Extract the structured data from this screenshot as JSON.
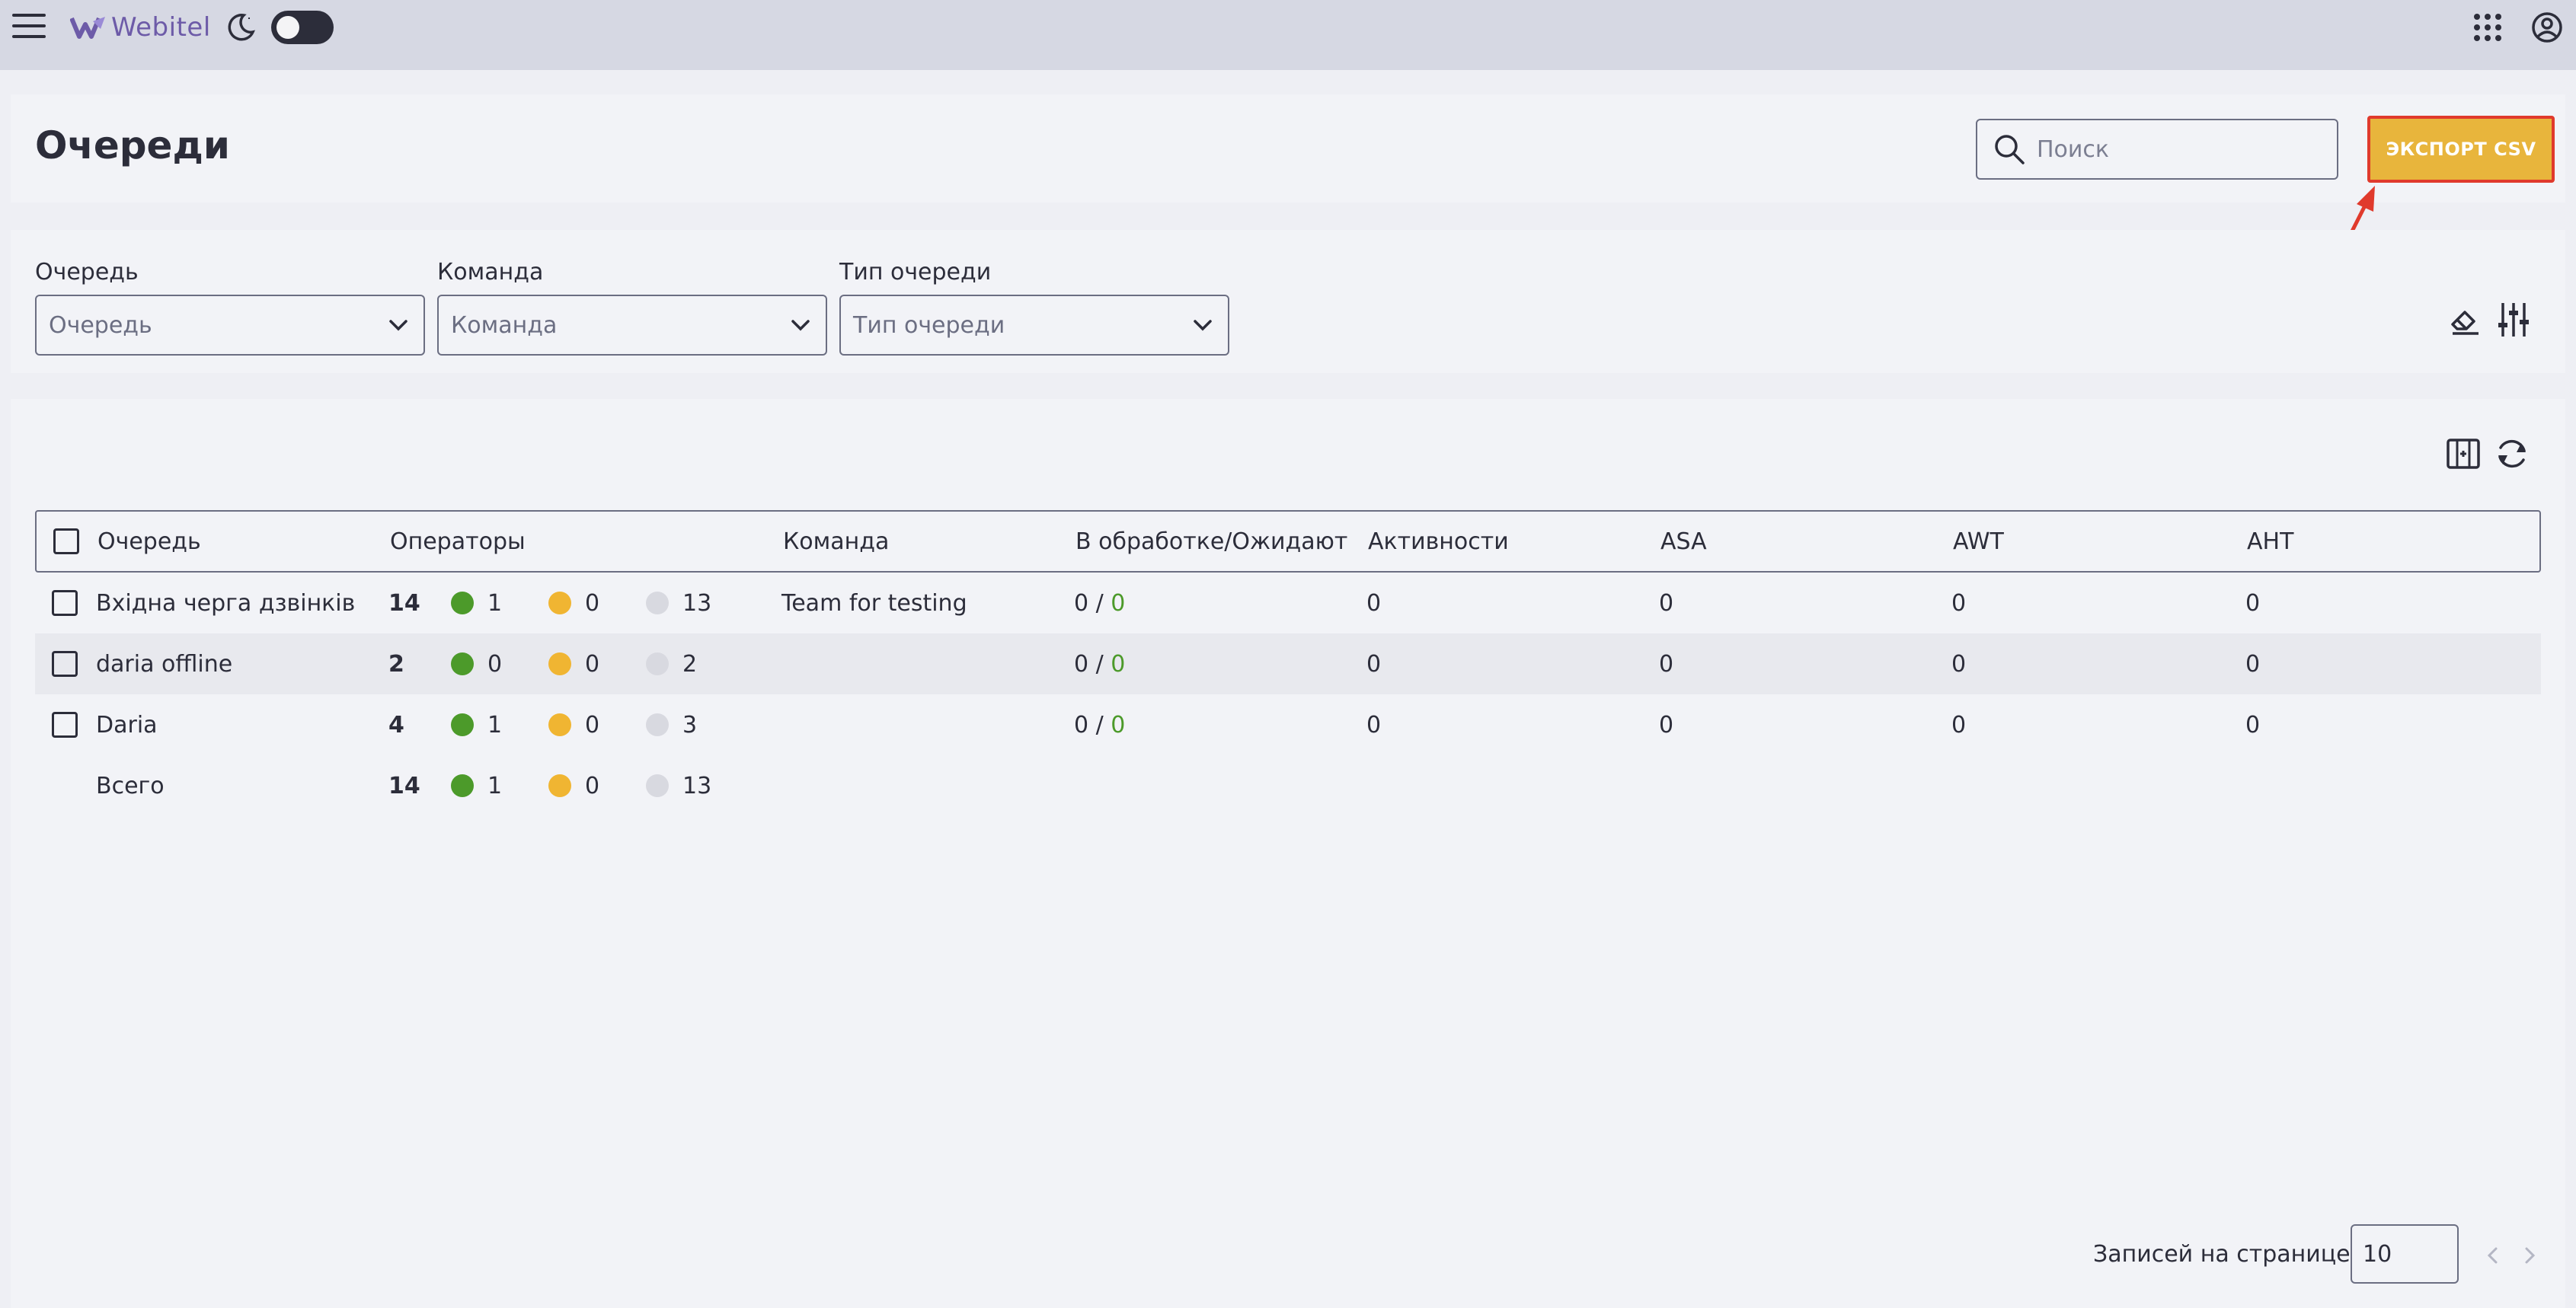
{
  "app": {
    "logo_text": "Webitel",
    "brand_color": "#6d5ba8"
  },
  "header": {
    "title": "Очереди",
    "search_placeholder": "Поиск",
    "export_label": "ЭКСПОРТ CSV",
    "export_color": "#e8b53c",
    "highlight_color": "#e03a2c"
  },
  "filters": [
    {
      "label": "Очередь",
      "placeholder": "Очередь"
    },
    {
      "label": "Команда",
      "placeholder": "Команда"
    },
    {
      "label": "Тип очереди",
      "placeholder": "Тип очереди"
    }
  ],
  "table": {
    "columns": [
      "Очередь",
      "Операторы",
      "Команда",
      "В обработке/Ожидают",
      "Активности",
      "ASA",
      "AWT",
      "AHT"
    ],
    "rows": [
      {
        "queue": "Вхідна черга дзвінків",
        "total": "14",
        "online": "1",
        "pause": "0",
        "offline": "13",
        "team": "Team for testing",
        "processing": "0",
        "waiting": "0",
        "activities": "0",
        "asa": "0",
        "awt": "0",
        "aht": "0"
      },
      {
        "queue": "daria offline",
        "total": "2",
        "online": "0",
        "pause": "0",
        "offline": "2",
        "team": "",
        "processing": "0",
        "waiting": "0",
        "activities": "0",
        "asa": "0",
        "awt": "0",
        "aht": "0"
      },
      {
        "queue": "Daria",
        "total": "4",
        "online": "1",
        "pause": "0",
        "offline": "3",
        "team": "",
        "processing": "0",
        "waiting": "0",
        "activities": "0",
        "asa": "0",
        "awt": "0",
        "aht": "0"
      }
    ],
    "summary": {
      "label": "Всего",
      "total": "14",
      "online": "1",
      "pause": "0",
      "offline": "13"
    },
    "status_colors": {
      "online": "#4c9a2a",
      "pause": "#f0b532",
      "offline": "#d8d9e0"
    }
  },
  "pagination": {
    "per_page_label": "Записей на странице:",
    "per_page_value": "10"
  }
}
